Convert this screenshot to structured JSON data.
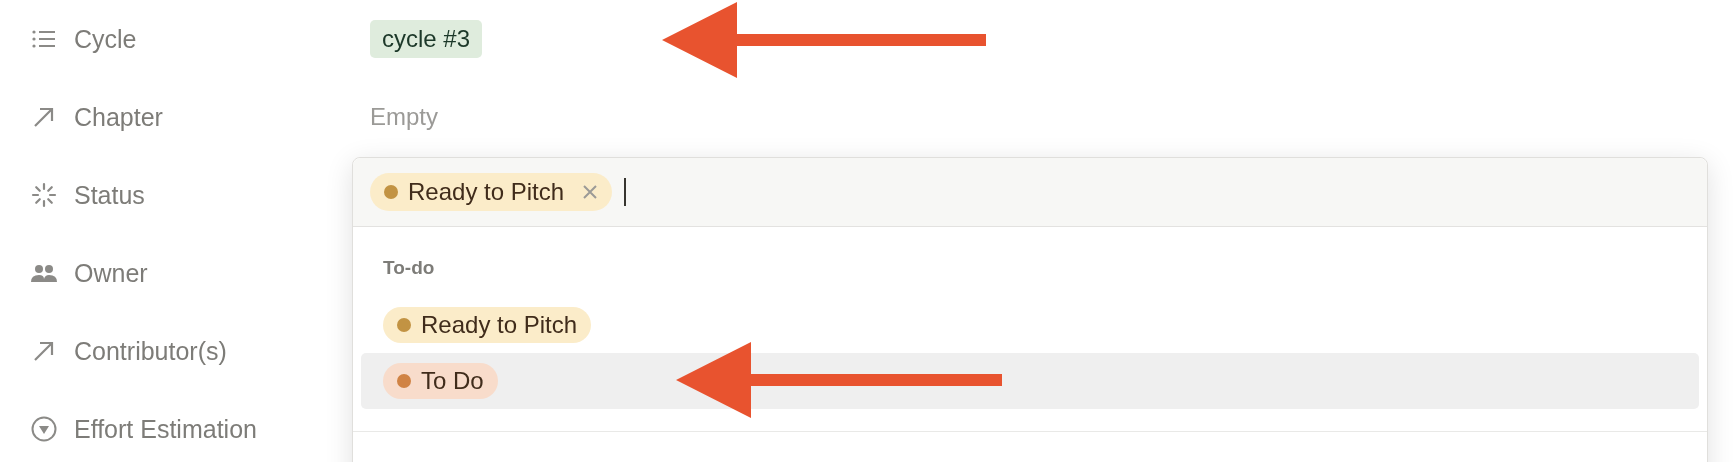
{
  "properties": [
    {
      "kind": "list",
      "label": "Cycle",
      "value": {
        "kind": "tag",
        "text": "cycle #3",
        "color": "#dfecdd"
      }
    },
    {
      "kind": "relation",
      "label": "Chapter",
      "value": {
        "kind": "empty",
        "text": "Empty"
      }
    },
    {
      "kind": "status",
      "label": "Status"
    },
    {
      "kind": "people",
      "label": "Owner"
    },
    {
      "kind": "relation",
      "label": "Contributor(s)"
    },
    {
      "kind": "select",
      "label": "Effort Estimation"
    }
  ],
  "status_picker": {
    "chosen": [
      {
        "text": "Ready to Pitch",
        "color": "#c29343"
      }
    ],
    "groups": [
      {
        "title": "To-do",
        "options": [
          {
            "text": "Ready to Pitch",
            "color": "#c29343",
            "highlighted": false
          },
          {
            "text": "To Do",
            "color": "#d08344",
            "highlighted": true
          }
        ]
      }
    ]
  }
}
